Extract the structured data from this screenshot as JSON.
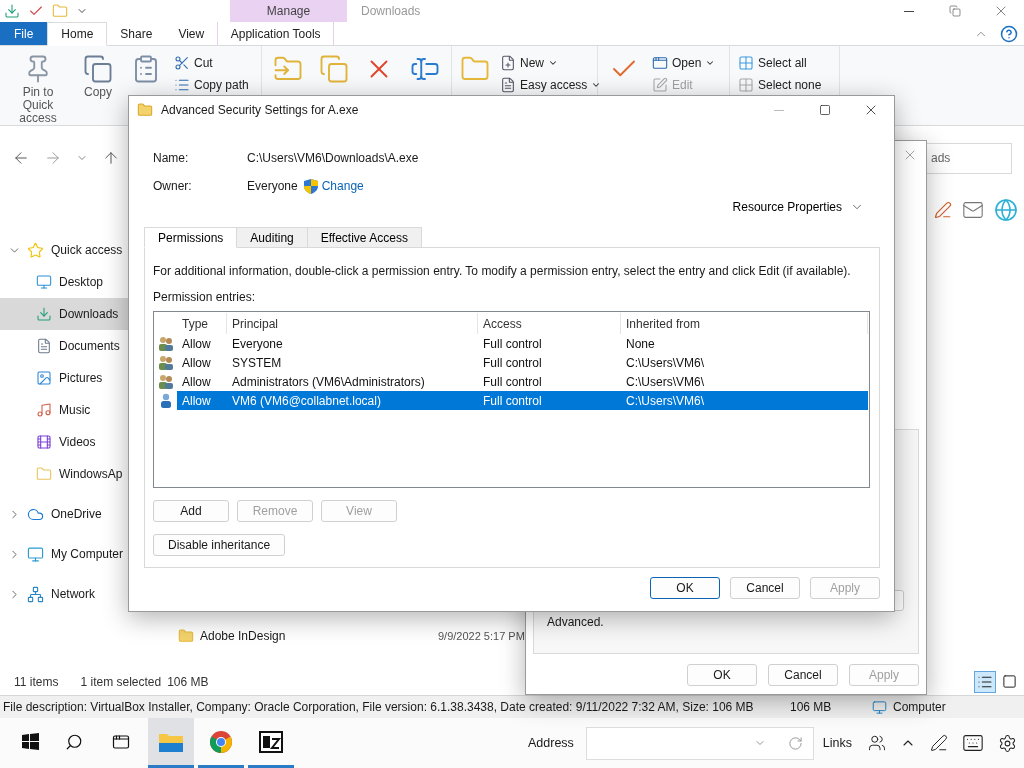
{
  "explorer": {
    "contextual_tab": "Manage",
    "title": "Downloads",
    "ribbon_tabs": [
      {
        "label": "File",
        "kind": "menu",
        "selected": false
      },
      {
        "label": "Home",
        "kind": "tab",
        "selected": true
      },
      {
        "label": "Share",
        "kind": "tab",
        "selected": false
      },
      {
        "label": "View",
        "kind": "tab",
        "selected": false
      },
      {
        "label": "Application Tools",
        "kind": "contextual",
        "selected": false
      }
    ],
    "ribbon_groups": [
      {
        "big": [
          {
            "kind": "pin",
            "label": "Pin to Quick access"
          },
          {
            "kind": "copy",
            "label": "Copy"
          },
          {
            "kind": "paste"
          }
        ],
        "small": [
          {
            "kind": "cut",
            "label": "Cut",
            "dropdown": false,
            "disabled": false
          },
          {
            "kind": "copypath",
            "label": "Copy path",
            "dropdown": false,
            "disabled": false
          }
        ]
      },
      {
        "big": [
          {
            "kind": "move"
          },
          {
            "kind": "copyto"
          },
          {
            "kind": "delete"
          },
          {
            "kind": "rename"
          }
        ]
      },
      {
        "big": [
          {
            "kind": "folder"
          }
        ],
        "small": [
          {
            "kind": "new",
            "label": "New",
            "dropdown": true,
            "disabled": false
          },
          {
            "kind": "easy",
            "label": "Easy access",
            "dropdown": true,
            "disabled": false
          }
        ]
      },
      {
        "big": [
          {
            "kind": "properties"
          }
        ],
        "small": [
          {
            "kind": "open",
            "label": "Open",
            "dropdown": true,
            "disabled": false
          },
          {
            "kind": "edit",
            "label": "Edit",
            "dropdown": false,
            "disabled": true
          }
        ]
      },
      {
        "small": [
          {
            "kind": "selectall",
            "label": "Select all",
            "dropdown": false,
            "disabled": false
          },
          {
            "kind": "selectnone",
            "label": "Select none",
            "dropdown": false,
            "disabled": false
          }
        ]
      }
    ],
    "search": {
      "placeholder": "ads"
    },
    "sidebar": [
      {
        "label": "Quick access",
        "kind": "quick",
        "expanded": true,
        "children": [
          {
            "label": "Desktop",
            "kind": "desktop",
            "selected": false
          },
          {
            "label": "Downloads",
            "kind": "downloads",
            "selected": true
          },
          {
            "label": "Documents",
            "kind": "documents",
            "selected": false
          },
          {
            "label": "Pictures",
            "kind": "pictures",
            "selected": false
          },
          {
            "label": "Music",
            "kind": "music",
            "selected": false
          },
          {
            "label": "Videos",
            "kind": "videos",
            "selected": false
          },
          {
            "label": "WindowsAp",
            "kind": "folder",
            "selected": false
          }
        ]
      },
      {
        "label": "OneDrive",
        "kind": "cloud",
        "expanded": false
      },
      {
        "label": "My Computer",
        "kind": "computer",
        "expanded": false
      },
      {
        "label": "Network",
        "kind": "network",
        "expanded": false
      }
    ],
    "files": [
      {
        "name": "Adobe InDesign",
        "date": "9/9/2022 5:17 PM"
      }
    ],
    "status": {
      "count": "11 items",
      "selection": "1 item selected",
      "size": "106 MB"
    },
    "view_buttons": [
      {
        "kind": "details",
        "selected": true
      },
      {
        "kind": "tiles",
        "selected": false
      }
    ]
  },
  "details_bar": {
    "description": "File description: VirtualBox Installer, Company: Oracle Corporation, File version: 6.1.38.3438, Date created: 9/11/2022 7:32 AM, Size: 106 MB",
    "size": "106 MB",
    "zone": "Computer"
  },
  "properties_dialog": {
    "note": "Advanced.",
    "buttons": [
      {
        "label": "OK",
        "default": false,
        "disabled": false
      },
      {
        "label": "Cancel",
        "default": false,
        "disabled": false
      },
      {
        "label": "Apply",
        "default": false,
        "disabled": true
      }
    ]
  },
  "advanced_dialog": {
    "title": "Advanced Security Settings for A.exe",
    "name_label": "Name:",
    "name": "C:\\Users\\VM6\\Downloads\\A.exe",
    "owner_label": "Owner:",
    "owner": "Everyone",
    "change_link": "Change",
    "resource_properties": "Resource Properties",
    "tabs": [
      {
        "label": "Permissions",
        "selected": true
      },
      {
        "label": "Auditing",
        "selected": false
      },
      {
        "label": "Effective Access",
        "selected": false
      }
    ],
    "info": "For additional information, double-click a permission entry. To modify a permission entry, select the entry and click Edit (if available).",
    "entries_label": "Permission entries:",
    "columns": [
      "Type",
      "Principal",
      "Access",
      "Inherited from"
    ],
    "rows": [
      {
        "kind": "group",
        "type": "Allow",
        "principal": "Everyone",
        "access": "Full control",
        "inherited_from": "None",
        "selected": false
      },
      {
        "kind": "group",
        "type": "Allow",
        "principal": "SYSTEM",
        "access": "Full control",
        "inherited_from": "C:\\Users\\VM6\\",
        "selected": false
      },
      {
        "kind": "group",
        "type": "Allow",
        "principal": "Administrators (VM6\\Administrators)",
        "access": "Full control",
        "inherited_from": "C:\\Users\\VM6\\",
        "selected": false
      },
      {
        "kind": "user",
        "type": "Allow",
        "principal": "VM6 (VM6@collabnet.local)",
        "access": "Full control",
        "inherited_from": "C:\\Users\\VM6\\",
        "selected": true
      }
    ],
    "entry_buttons": [
      {
        "label": "Add",
        "disabled": false
      },
      {
        "label": "Remove",
        "disabled": true
      },
      {
        "label": "View",
        "disabled": true
      }
    ],
    "inheritance_button": "Disable inheritance",
    "buttons": [
      {
        "label": "OK",
        "default": true,
        "disabled": false
      },
      {
        "label": "Cancel",
        "default": false,
        "disabled": false
      },
      {
        "label": "Apply",
        "default": false,
        "disabled": true
      }
    ]
  },
  "taskbar": {
    "apps": [
      {
        "kind": "explorer",
        "active": true
      },
      {
        "kind": "chrome",
        "active": false
      },
      {
        "kind": "sevenzip",
        "active": false
      }
    ],
    "address_label": "Address",
    "links_label": "Links"
  }
}
